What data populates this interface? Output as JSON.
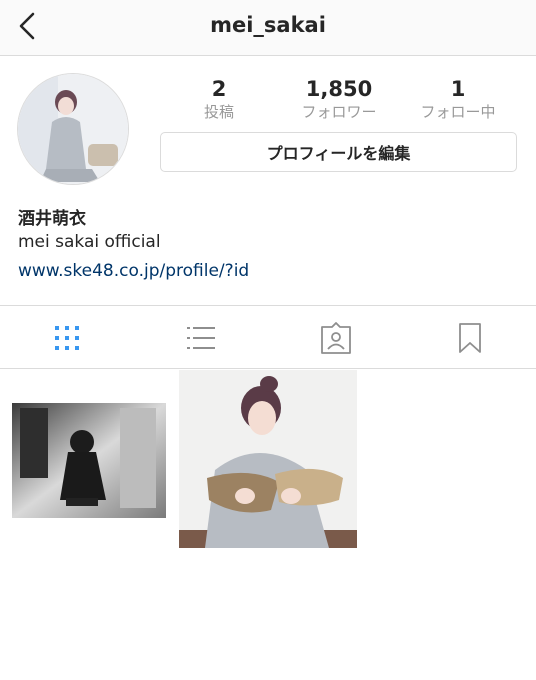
{
  "header": {
    "username": "mei_sakai"
  },
  "profile": {
    "stats": [
      {
        "value": "2",
        "label": "投稿"
      },
      {
        "value": "1,850",
        "label": "フォロワー"
      },
      {
        "value": "1",
        "label": "フォロー中"
      }
    ],
    "edit_button_label": "プロフィールを編集",
    "full_name": "酒井萌衣",
    "bio": "mei sakai official",
    "link": "www.ske48.co.jp/profile/?id"
  },
  "tabs": [
    {
      "icon": "grid-icon",
      "active": true
    },
    {
      "icon": "list-icon",
      "active": false
    },
    {
      "icon": "tagged-photos-icon",
      "active": false
    },
    {
      "icon": "bookmark-icon",
      "active": false
    }
  ],
  "colors": {
    "accent": "#3897f0",
    "link": "#003569",
    "muted": "#999999",
    "border": "#dbdbdb"
  }
}
